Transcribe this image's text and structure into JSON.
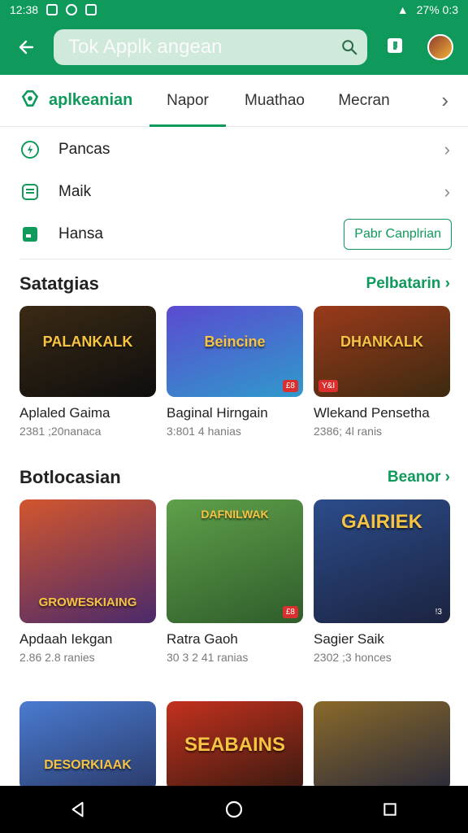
{
  "status": {
    "time": "12:38",
    "right": "27%  0:3"
  },
  "search": {
    "value": "Tok Applk angean",
    "placeholder": "Tok Applk angean"
  },
  "brand": {
    "label": "aplkeanian"
  },
  "tabs": [
    {
      "label": "Napor",
      "active": true
    },
    {
      "label": "Muathao",
      "active": false
    },
    {
      "label": "Mecran",
      "active": false
    }
  ],
  "quick": {
    "items": [
      {
        "label": "Pancas",
        "icon": "lightning-circle-icon"
      },
      {
        "label": "Maik",
        "icon": "inbox-icon"
      },
      {
        "label": "Hansa",
        "icon": "folder-icon"
      }
    ],
    "action_label": "Pabr Canplrian"
  },
  "sections": [
    {
      "title": "Satatgias",
      "more": "Pelbatarin ›",
      "cards": [
        {
          "title": "Aplaled Gaima",
          "sub": "2381 ;20nanaca",
          "img_text": "PALANKALK",
          "bg": "linear-gradient(160deg,#3a2a14,#0e0e0e)"
        },
        {
          "title": "Baginal Hirngain",
          "sub": "3:801 4 hanias",
          "img_text": "Beincine",
          "bg": "linear-gradient(160deg,#5b4ad0,#2f9acb)",
          "badge": "£8"
        },
        {
          "title": "Wlekand Pensetha",
          "sub": "2386; 4l ranis",
          "img_text": "DHANKALK",
          "bg": "linear-gradient(160deg,#9b3a1b,#3c2a10)",
          "badge": "Y&I"
        }
      ]
    },
    {
      "title": "Botlocasian",
      "more": "Beanor ›",
      "cards": [
        {
          "title": "Apdaah Iekgan",
          "sub": "2.86 2.8 ranies",
          "img_text": "GROWESKIAING",
          "bg": "linear-gradient(160deg,#d2562e,#4b2a6a)"
        },
        {
          "title": "Ratra Gaoh",
          "sub": "30 3 2 41 ranias",
          "img_text": "DAFNILWAK",
          "bg": "linear-gradient(160deg,#5fa04a,#2f5d2b)",
          "badge": "£8"
        },
        {
          "title": "Sagier Saik",
          "sub": "2302 ;3 honces",
          "img_text": "GAIRIEK",
          "bg": "linear-gradient(160deg,#2b4c8a,#1c2340)",
          "badge": "!3"
        }
      ]
    },
    {
      "title": "",
      "more": "",
      "cards": [
        {
          "title": "",
          "sub": "",
          "img_text": "DESORKIAAK",
          "bg": "linear-gradient(160deg,#4a7bd0,#2a3a6a)"
        },
        {
          "title": "",
          "sub": "",
          "img_text": "SEABAINS",
          "bg": "linear-gradient(160deg,#c3311e,#3a1a10)"
        },
        {
          "title": "",
          "sub": "",
          "img_text": "",
          "bg": "linear-gradient(160deg,#8a6a2a,#2a2a3a)"
        }
      ]
    }
  ],
  "nav": {
    "back": "back-icon",
    "home": "home-icon",
    "recents": "recents-icon"
  },
  "colors": {
    "accent": "#0f9a5c",
    "toolbar": "#0f9a5c"
  }
}
